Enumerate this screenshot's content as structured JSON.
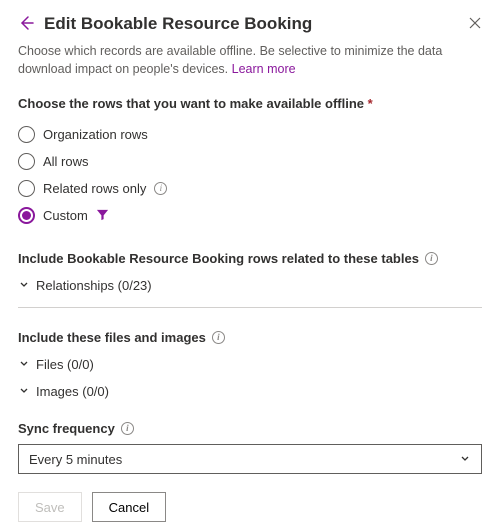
{
  "header": {
    "title": "Edit Bookable Resource Booking",
    "subtitle": "Choose which records are available offline. Be selective to minimize the data download impact on people's devices.",
    "learn_more": "Learn more"
  },
  "fields": {
    "chooseRows": {
      "label": "Choose the rows that you want to make available offline",
      "options": {
        "org": "Organization rows",
        "all": "All rows",
        "related": "Related rows only",
        "custom": "Custom"
      }
    },
    "includeRelated": {
      "label": "Include Bookable Resource Booking rows related to these tables",
      "relationships": "Relationships (0/23)"
    },
    "includeFiles": {
      "label": "Include these files and images",
      "files": "Files (0/0)",
      "images": "Images (0/0)"
    },
    "syncFreq": {
      "label": "Sync frequency",
      "value": "Every 5 minutes"
    }
  },
  "footer": {
    "save": "Save",
    "cancel": "Cancel"
  }
}
